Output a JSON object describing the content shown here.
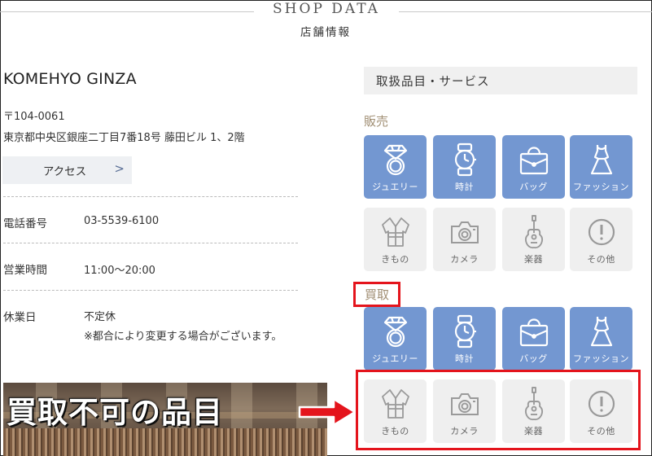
{
  "header": {
    "title": "SHOP DATA",
    "subtitle": "店舗情報"
  },
  "shop": {
    "name": "KOMEHYO GINZA",
    "zip": "〒104-0061",
    "address": "東京都中央区銀座二丁目7番18号 藤田ビル 1、2階",
    "access_label": "アクセス",
    "access_chevron": ">"
  },
  "info": [
    {
      "label": "電話番号",
      "value": "03-5539-6100"
    },
    {
      "label": "営業時間",
      "value": "11:00〜20:00"
    },
    {
      "label": "休業日",
      "value": "不定休",
      "note": "※都合により変更する場合がございます。"
    }
  ],
  "services": {
    "header": "取扱品目・サービス",
    "sell_title": "販売",
    "buy_title": "買取",
    "sell": [
      {
        "label": "ジュエリー",
        "icon": "ring-icon",
        "available": true
      },
      {
        "label": "時計",
        "icon": "watch-icon",
        "available": true
      },
      {
        "label": "バッグ",
        "icon": "bag-icon",
        "available": true
      },
      {
        "label": "ファッション",
        "icon": "dress-icon",
        "available": true
      },
      {
        "label": "きもの",
        "icon": "kimono-icon",
        "available": false
      },
      {
        "label": "カメラ",
        "icon": "camera-icon",
        "available": false
      },
      {
        "label": "楽器",
        "icon": "guitar-icon",
        "available": false
      },
      {
        "label": "その他",
        "icon": "exclamation-icon",
        "available": false
      }
    ],
    "buy": [
      {
        "label": "ジュエリー",
        "icon": "ring-icon",
        "available": true
      },
      {
        "label": "時計",
        "icon": "watch-icon",
        "available": true
      },
      {
        "label": "バッグ",
        "icon": "bag-icon",
        "available": true
      },
      {
        "label": "ファッション",
        "icon": "dress-icon",
        "available": true
      },
      {
        "label": "きもの",
        "icon": "kimono-icon",
        "available": false
      },
      {
        "label": "カメラ",
        "icon": "camera-icon",
        "available": false
      },
      {
        "label": "楽器",
        "icon": "guitar-icon",
        "available": false
      },
      {
        "label": "その他",
        "icon": "exclamation-icon",
        "available": false
      }
    ]
  },
  "annotation": {
    "text": "買取不可の品目"
  },
  "colors": {
    "tile_on": "#7397d1",
    "tile_off": "#efefef",
    "highlight_red": "#e4141c",
    "section_title": "#a08e73"
  }
}
